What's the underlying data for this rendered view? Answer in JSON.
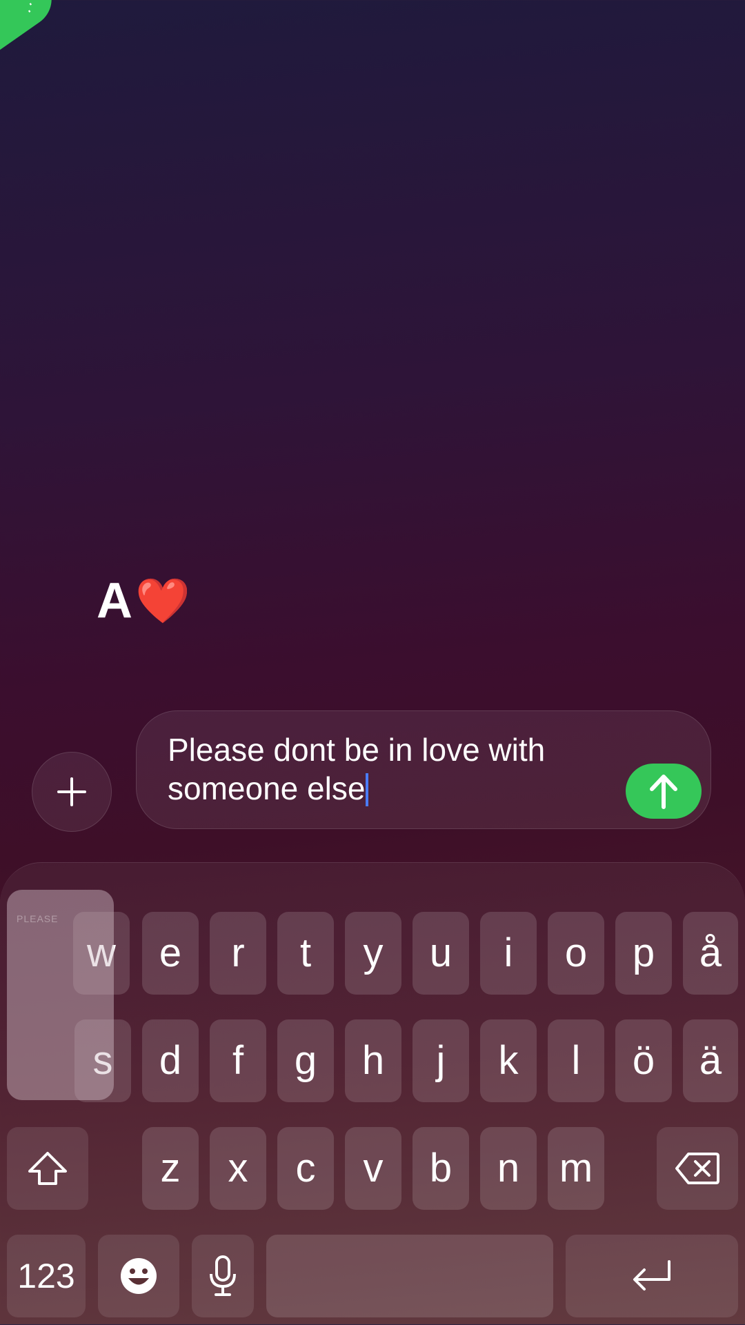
{
  "sticker": {
    "letter": "A",
    "heart": "❤️"
  },
  "composer": {
    "plus_label": "+",
    "message_text": "Please dont be in love with someone else"
  },
  "keyboard": {
    "popup_label": "PLEASE",
    "row1": [
      "w",
      "e",
      "r",
      "t",
      "y",
      "u",
      "i",
      "o",
      "p",
      "å"
    ],
    "row2": [
      "s",
      "d",
      "f",
      "g",
      "h",
      "j",
      "k",
      "l",
      "ö",
      "ä"
    ],
    "row3": [
      "z",
      "x",
      "c",
      "v",
      "b",
      "n",
      "m"
    ],
    "numbers_label": "123"
  },
  "colors": {
    "send_green": "#35c759",
    "caret_blue": "#4a7cf6"
  },
  "icons": {
    "shift": "shift-icon",
    "backspace": "backspace-icon",
    "emoji": "emoji-icon",
    "mic": "microphone-icon",
    "return": "return-icon",
    "send": "arrow-up-icon"
  }
}
